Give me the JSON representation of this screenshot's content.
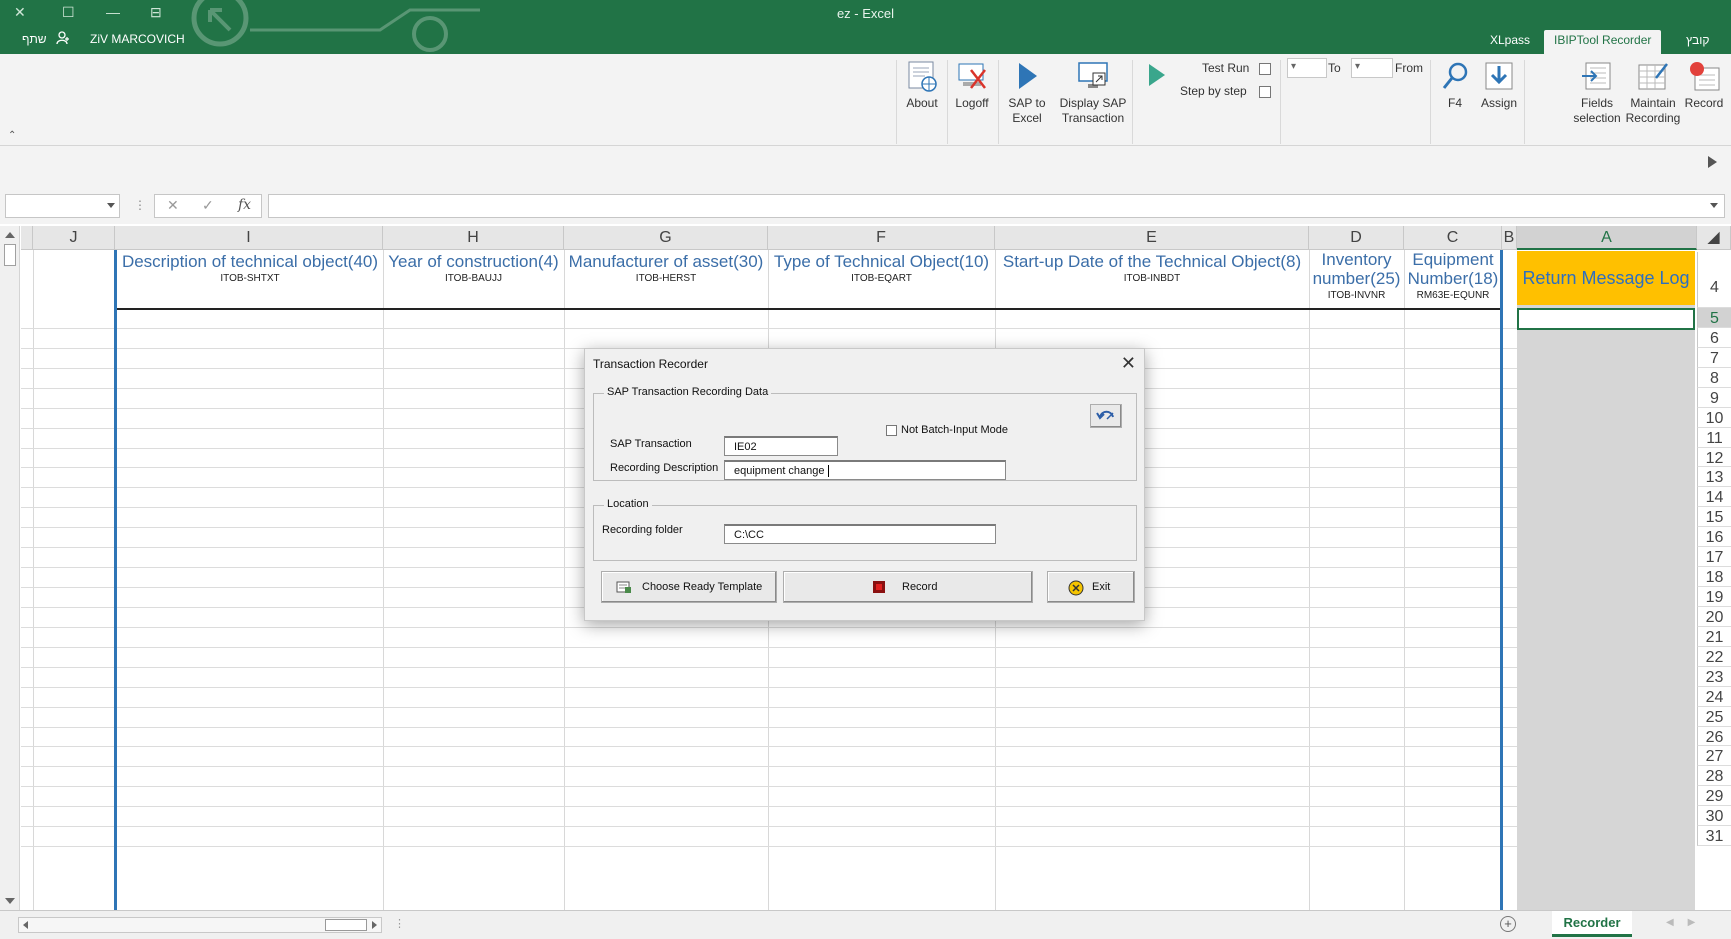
{
  "window": {
    "title": "ez - Excel",
    "user_name": "ZiV MARCOVICH",
    "share_label": "שתף"
  },
  "tabs": [
    {
      "label": "XLpass"
    },
    {
      "label": "IBIPTool Recorder",
      "active": true
    },
    {
      "label": "קובץ"
    }
  ],
  "ribbon": {
    "about": "About",
    "logoff": "Logoff",
    "sap_to_excel_1": "SAP to",
    "sap_to_excel_2": "Excel",
    "display_sap_1": "Display SAP",
    "display_sap_2": "Transaction",
    "test_run": "Test Run",
    "step_by_step": "Step by step",
    "to_label": "To",
    "from_label": "From",
    "f4": "F4",
    "assign": "Assign",
    "fields_1": "Fields",
    "fields_2": "selection",
    "maintain_1": "Maintain",
    "maintain_2": "Recording",
    "record": "Record"
  },
  "columns": [
    "J",
    "I",
    "H",
    "G",
    "F",
    "E",
    "D",
    "C",
    "B",
    "A"
  ],
  "headers": {
    "I": {
      "main": "Description of technical object(40)",
      "sub": "ITOB-SHTXT"
    },
    "H": {
      "main": "Year of construction(4)",
      "sub": "ITOB-BAUJJ"
    },
    "G": {
      "main": "Manufacturer of asset(30)",
      "sub": "ITOB-HERST"
    },
    "F": {
      "main": "Type of Technical Object(10)",
      "sub": "ITOB-EQART"
    },
    "E": {
      "main": "Start-up Date of the Technical Object(8)",
      "sub": "ITOB-INBDT"
    },
    "D": {
      "main1": "Inventory",
      "main2": "number(25)",
      "sub": "ITOB-INVNR"
    },
    "C": {
      "main1": "Equipment",
      "main2": "Number(18)",
      "sub": "RM63E-EQUNR"
    },
    "A": {
      "main": "Return Message Log"
    }
  },
  "rows": [
    "4",
    "5",
    "6",
    "7",
    "8",
    "9",
    "10",
    "11",
    "12",
    "13",
    "14",
    "15",
    "16",
    "17",
    "18",
    "19",
    "20",
    "21",
    "22",
    "23",
    "24",
    "25",
    "26",
    "27",
    "28",
    "29",
    "30",
    "31"
  ],
  "dialog": {
    "title": "Transaction Recorder",
    "group1": "SAP Transaction Recording Data",
    "sap_transaction_label": "SAP Transaction",
    "sap_transaction_value": "IE02",
    "not_batch_label": "Not Batch-Input Mode",
    "desc_label": "Recording Description",
    "desc_value": "equipment change",
    "group2": "Location",
    "folder_label": "Recording folder",
    "folder_value": "C:\\CC",
    "choose_btn": "Choose Ready Template",
    "record_btn": "Record",
    "exit_btn": "Exit"
  },
  "sheet_tab": "Recorder",
  "colors": {
    "excel_green": "#217346",
    "header_blue": "#3b6ea8",
    "return_log_bg": "#ffc000"
  }
}
